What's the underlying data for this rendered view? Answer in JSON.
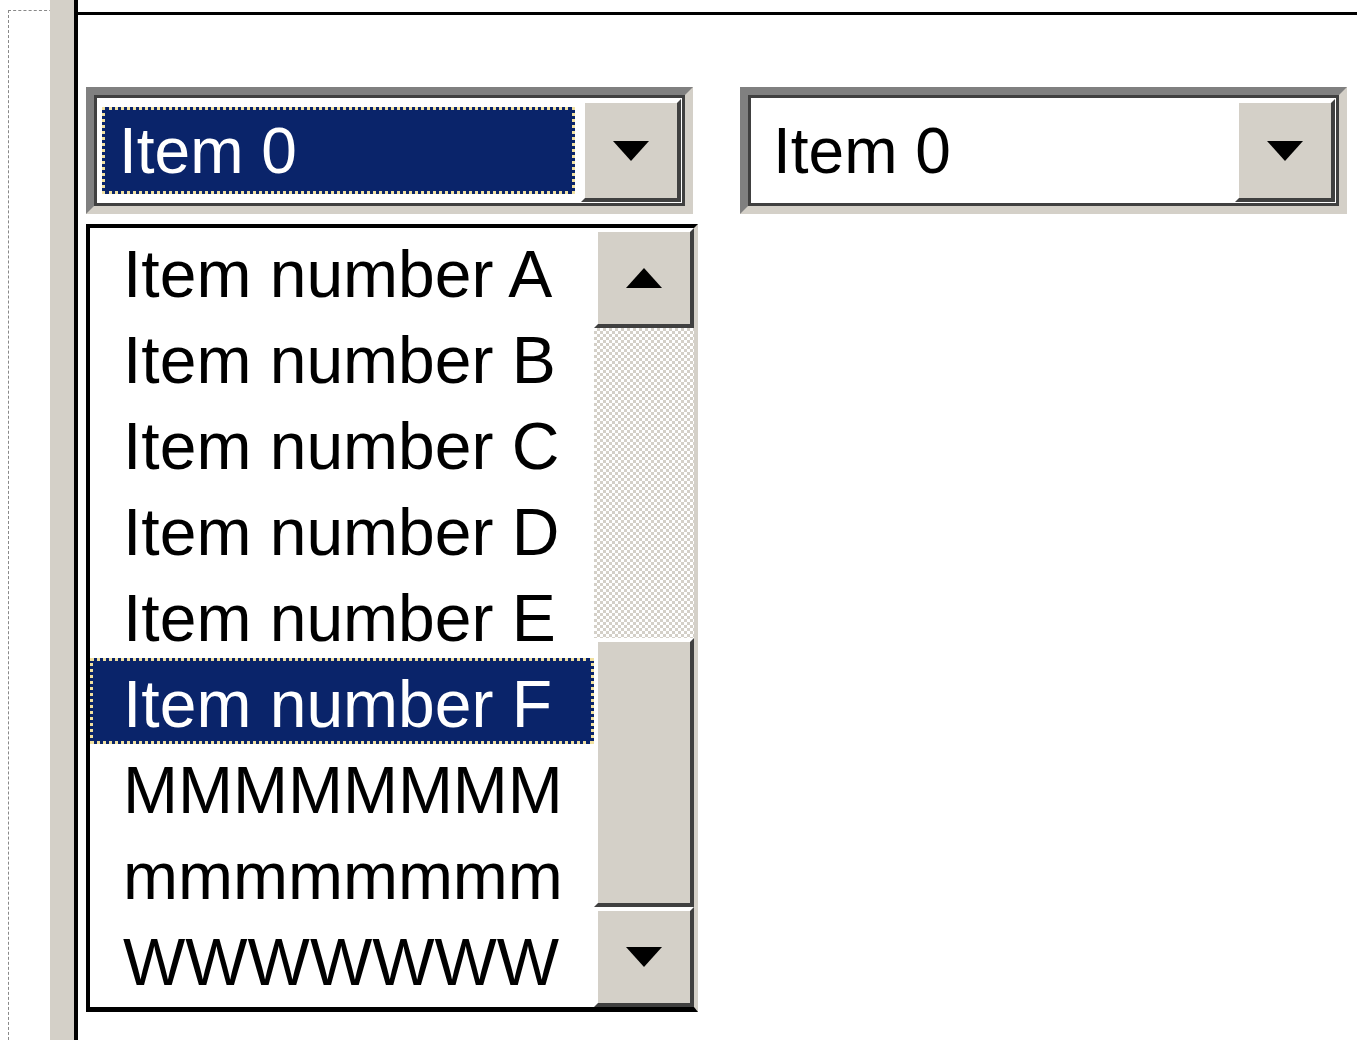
{
  "combo_boxes": [
    {
      "value": "Item 0",
      "focused": true
    },
    {
      "value": "Item 0",
      "focused": false
    }
  ],
  "dropdown_list": {
    "items": [
      {
        "label": "Item number A",
        "selected": false
      },
      {
        "label": "Item number B",
        "selected": false
      },
      {
        "label": "Item number C",
        "selected": false
      },
      {
        "label": "Item number D",
        "selected": false
      },
      {
        "label": "Item number E",
        "selected": false
      },
      {
        "label": "Item number F",
        "selected": true
      },
      {
        "label": "MMMMMMMM",
        "selected": false
      },
      {
        "label": "mmmmmmmm",
        "selected": false
      },
      {
        "label": "WWWWWWW",
        "selected": false
      }
    ]
  }
}
